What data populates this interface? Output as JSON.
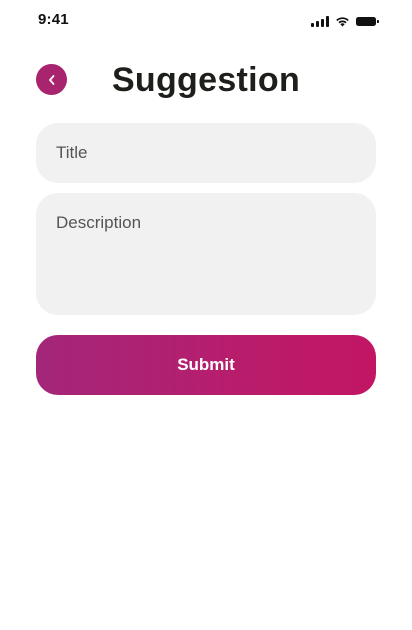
{
  "status_bar": {
    "time": "9:41",
    "icons": [
      "signal-icon",
      "wifi-icon",
      "battery-icon"
    ]
  },
  "header": {
    "title": "Suggestion",
    "back_icon": "chevron-left-icon"
  },
  "form": {
    "title_placeholder": "Title",
    "description_placeholder": "Description",
    "submit_label": "Submit"
  },
  "colors": {
    "accent": "#a9246f",
    "button_gradient_start": "#a3267a",
    "button_gradient_end": "#c21564",
    "field_background": "#f1f1f1",
    "title_text": "#1c1f1a"
  }
}
